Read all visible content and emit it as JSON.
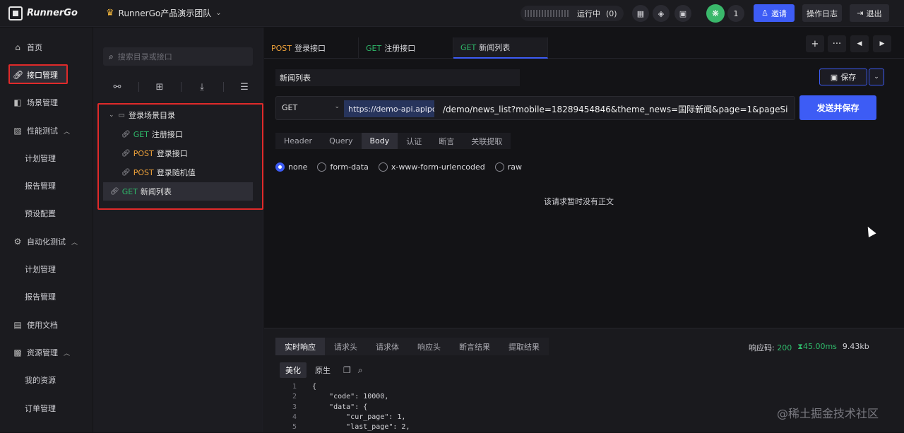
{
  "app": {
    "name": "RunnerGo",
    "team": "RunnerGo产品演示团队"
  },
  "topbar": {
    "running_label": "运行中",
    "running_count": "(0)",
    "user_count": "1",
    "invite_label": "邀请",
    "oplog_label": "操作日志",
    "logout_label": "退出"
  },
  "sidebar": {
    "items": [
      {
        "label": "首页",
        "icon": "home-icon"
      },
      {
        "label": "接口管理",
        "icon": "link-icon",
        "active": true
      },
      {
        "label": "场景管理",
        "icon": "scene-icon"
      },
      {
        "label": "性能测试",
        "icon": "chart-icon",
        "expanded": true
      },
      {
        "label": "计划管理"
      },
      {
        "label": "报告管理"
      },
      {
        "label": "预设配置"
      },
      {
        "label": "自动化测试",
        "icon": "automation-icon",
        "expanded": true
      },
      {
        "label": "计划管理"
      },
      {
        "label": "报告管理"
      },
      {
        "label": "使用文档",
        "icon": "doc-icon"
      },
      {
        "label": "资源管理",
        "icon": "resource-icon",
        "expanded": true
      },
      {
        "label": "我的资源"
      },
      {
        "label": "订单管理"
      }
    ]
  },
  "tree": {
    "search_placeholder": "搜索目录或接口",
    "folder": "登录场景目录",
    "items": [
      {
        "method": "GET",
        "name": "注册接口"
      },
      {
        "method": "POST",
        "name": "登录接口"
      },
      {
        "method": "POST",
        "name": "登录随机值"
      }
    ],
    "root_item": {
      "method": "GET",
      "name": "新闻列表"
    }
  },
  "tabs": [
    {
      "method": "POST",
      "name": "登录接口"
    },
    {
      "method": "GET",
      "name": "注册接口"
    },
    {
      "method": "GET",
      "name": "新闻列表",
      "active": true
    }
  ],
  "request": {
    "name": "新闻列表",
    "save_label": "保存",
    "method": "GET",
    "domain": "https://demo-api.apipc",
    "path": "/demo/news_list?mobile=18289454846&theme_news=国际新闻&page=1&pageSi",
    "send_label": "发送并保存",
    "tabs": [
      "Header",
      "Query",
      "Body",
      "认证",
      "断言",
      "关联提取"
    ],
    "active_tab": "Body",
    "body_types": [
      "none",
      "form-data",
      "x-www-form-urlencoded",
      "raw"
    ],
    "selected_body_type": "none",
    "empty_message": "该请求暂时没有正文"
  },
  "response": {
    "tabs": [
      "实时响应",
      "请求头",
      "请求体",
      "响应头",
      "断言结果",
      "提取结果"
    ],
    "status_label": "响应码:",
    "status_code": "200",
    "time": "45.00ms",
    "size": "9.43kb",
    "view_tabs": [
      "美化",
      "原生"
    ],
    "code_lines": [
      {
        "n": "1",
        "text": "{"
      },
      {
        "n": "2",
        "text": "    \"code\": 10000,"
      },
      {
        "n": "3",
        "text": "    \"data\": {"
      },
      {
        "n": "4",
        "text": "        \"cur_page\": 1,"
      },
      {
        "n": "5",
        "text": "        \"last_page\": 2,"
      }
    ]
  },
  "watermark": "@稀土掘金技术社区",
  "colors": {
    "accent": "#3d5cf5",
    "get": "#2fb96a",
    "post": "#f0a33a",
    "highlight": "#e02a2a"
  }
}
